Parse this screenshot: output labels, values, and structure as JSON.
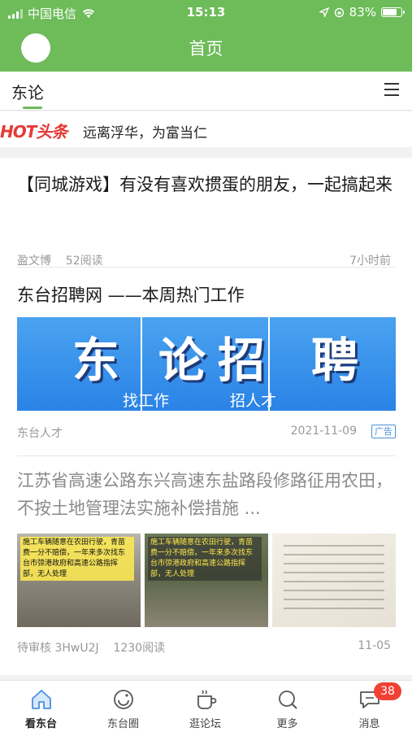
{
  "status_bar": {
    "carrier": "中国电信",
    "time": "15:13",
    "battery": "83%",
    "battery_level": 0.83
  },
  "nav": {
    "title": "首页"
  },
  "tabs": {
    "active": "东论"
  },
  "hot": {
    "logo": "HOT头条",
    "headline": "远离浮华，为富当仁"
  },
  "feed": [
    {
      "title": "【同城游戏】有没有喜欢掼蛋的朋友，一起搞起来",
      "author": "盈文博",
      "reads": "52阅读",
      "time": "7小时前"
    },
    {
      "title": "东台招聘网 ——本周热门工作",
      "banner_big": [
        "东",
        "论",
        "招",
        "聘"
      ],
      "banner_small_left": "找工作",
      "banner_small_right": "招人才",
      "author": "东台人才",
      "date": "2021-11-09",
      "badge": "广告"
    },
    {
      "title": "江苏省高速公路东兴高速东盐路段修路征用农田，不按土地管理法实施补偿措施 ...",
      "thumb1_caption": "施工车辆随意在农田行驶，青苗费一分不赔偿，一年来多次找东台市弶港政府和高速公路指挥部，无人处理",
      "thumb2_caption": "施工车辆随意在农田行驶，青苗费一分不赔偿，一年来多次找东台市弶港政府和高速公路指挥部，无人处理",
      "author": "待审核 3HwU2J",
      "reads": "1230阅读",
      "time": "11-05"
    }
  ],
  "bottom_tabs": [
    {
      "label": "看东台",
      "icon": "home-icon"
    },
    {
      "label": "东台圈",
      "icon": "circle-icon"
    },
    {
      "label": "逛论坛",
      "icon": "coffee-icon"
    },
    {
      "label": "更多",
      "icon": "search-icon"
    },
    {
      "label": "消息",
      "icon": "message-icon",
      "badge": "38"
    }
  ],
  "colors": {
    "brand_green": "#6dbb59",
    "hot_red": "#e53935",
    "badge_red": "#f04134",
    "ad_blue": "#4a90d9"
  }
}
